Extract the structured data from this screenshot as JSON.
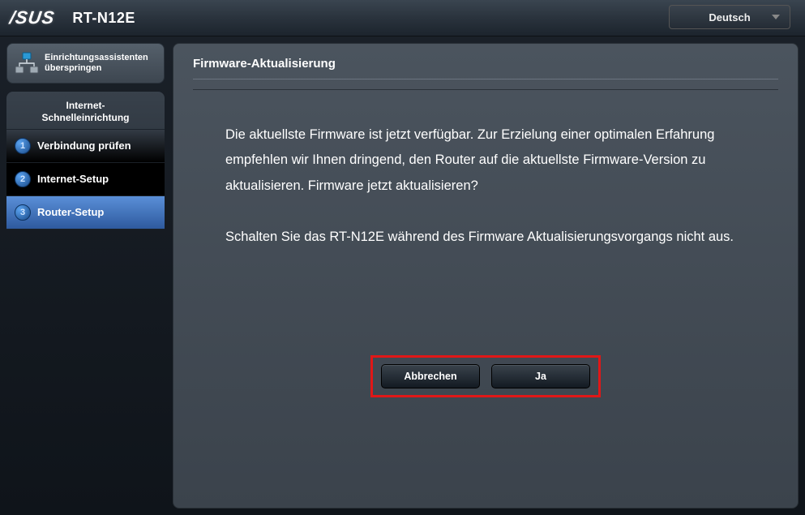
{
  "header": {
    "brand": "/SUS",
    "model": "RT-N12E",
    "language": "Deutsch"
  },
  "sidebar": {
    "skip_label": "Einrichtungsassistenten überspringen",
    "steps_title": "Internet-\nSchnelleinrichtung",
    "steps": [
      {
        "num": "1",
        "label": "Verbindung prüfen"
      },
      {
        "num": "2",
        "label": "Internet-Setup"
      },
      {
        "num": "3",
        "label": "Router-Setup"
      }
    ]
  },
  "panel": {
    "title": "Firmware-Aktualisierung",
    "paragraph1": "Die aktuellste Firmware ist jetzt verfügbar. Zur Erzielung einer optimalen Erfahrung empfehlen wir Ihnen dringend, den Router auf die aktuellste Firmware-Version zu aktualisieren. Firmware jetzt aktualisieren?",
    "paragraph2": "Schalten Sie das RT-N12E während des Firmware Aktualisierungsvorgangs nicht aus.",
    "cancel": "Abbrechen",
    "yes": "Ja"
  }
}
